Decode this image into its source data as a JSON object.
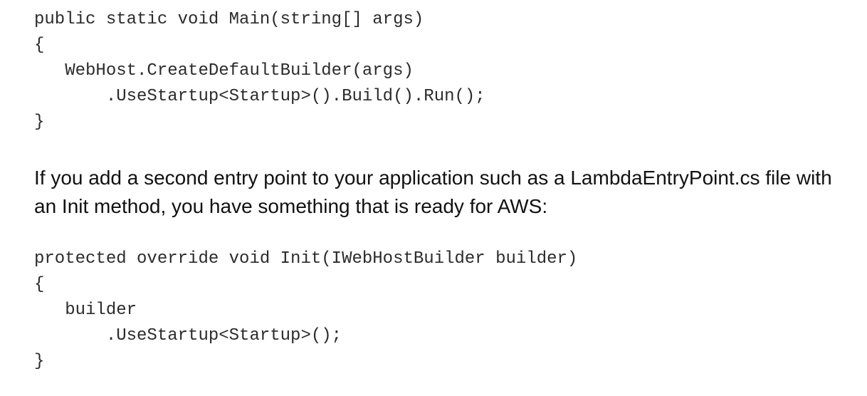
{
  "code_block_1": {
    "lines": [
      "public static void Main(string[] args)",
      "{",
      "   WebHost.CreateDefaultBuilder(args)",
      "       .UseStartup<Startup>().Build().Run();",
      "}"
    ]
  },
  "paragraph": {
    "text": "If you add a second entry point to your application such as a LambdaEntryPoint.cs file with an Init method, you have something that is ready for AWS:"
  },
  "code_block_2": {
    "lines": [
      "protected override void Init(IWebHostBuilder builder)",
      "{",
      "   builder",
      "       .UseStartup<Startup>();",
      "}"
    ]
  }
}
